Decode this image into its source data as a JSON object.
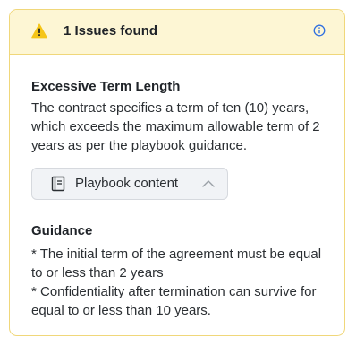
{
  "header": {
    "title": "1 Issues found",
    "warning_color": "#f5c518",
    "info_color": "#2f6fdf",
    "icons": [
      "warning-icon",
      "info-icon"
    ]
  },
  "issue": {
    "title": "Excessive Term Length",
    "description": "The contract specifies a term of ten (10) years, which exceeds the maximum allowable term of 2 years as per the playbook guidance."
  },
  "playbook": {
    "label": "Playbook content",
    "icons": [
      "book-icon",
      "chevron-up-icon"
    ]
  },
  "guidance": {
    "title": "Guidance",
    "items": [
      "* The initial term of the agreement must be equal to or less than 2 years",
      "* Confidentiality after termination can survive for equal to or less than 10 years."
    ]
  }
}
